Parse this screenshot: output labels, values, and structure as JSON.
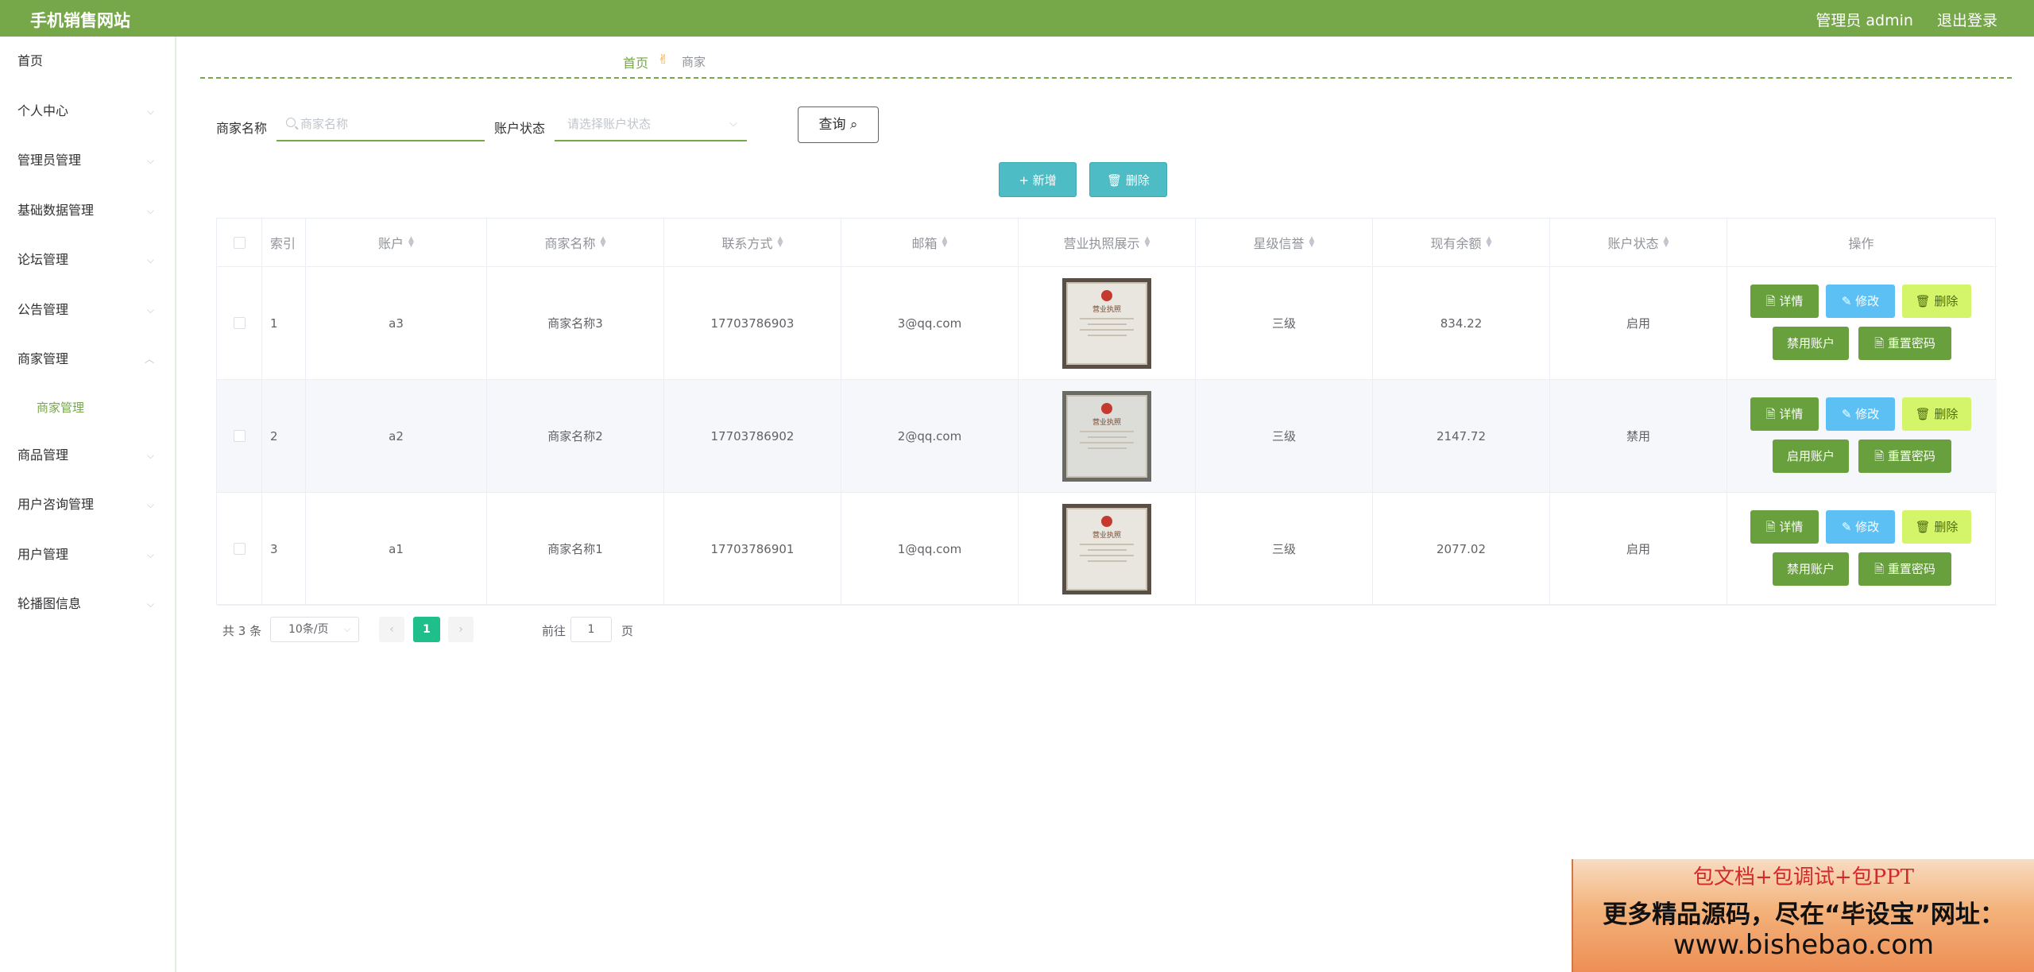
{
  "header": {
    "site_title": "手机销售网站",
    "user": "管理员 admin",
    "logout": "退出登录"
  },
  "sidebar": {
    "items": [
      {
        "label": "首页",
        "chevron": ""
      },
      {
        "label": "个人中心",
        "chevron": "⌵"
      },
      {
        "label": "管理员管理",
        "chevron": "⌵"
      },
      {
        "label": "基础数据管理",
        "chevron": "⌵"
      },
      {
        "label": "论坛管理",
        "chevron": "⌵"
      },
      {
        "label": "公告管理",
        "chevron": "⌵"
      },
      {
        "label": "商家管理",
        "chevron": "︿"
      },
      {
        "label": "商品管理",
        "chevron": "⌵"
      },
      {
        "label": "用户咨询管理",
        "chevron": "⌵"
      },
      {
        "label": "用户管理",
        "chevron": "⌵"
      },
      {
        "label": "轮播图信息",
        "chevron": "⌵"
      }
    ],
    "sub_item": "商家管理"
  },
  "breadcrumb": {
    "home": "首页",
    "sep": "✌",
    "current": "商家"
  },
  "search": {
    "name_label": "商家名称",
    "name_placeholder": "商家名称",
    "status_label": "账户状态",
    "status_placeholder": "请选择账户状态",
    "query_label": "查询 ⌕"
  },
  "toolbar": {
    "add_label": "+ 新增",
    "delete_label": "🗑 删除"
  },
  "table": {
    "headers": [
      "索引",
      "账户",
      "商家名称",
      "联系方式",
      "邮箱",
      "营业执照展示",
      "星级信誉",
      "现有余额",
      "账户状态",
      "操作"
    ],
    "rows": [
      {
        "index": "1",
        "account": "a3",
        "name": "商家名称3",
        "phone": "17703786903",
        "email": "3@qq.com",
        "credit": "三级",
        "balance": "834.22",
        "status": "启用",
        "toggle": "禁用账户"
      },
      {
        "index": "2",
        "account": "a2",
        "name": "商家名称2",
        "phone": "17703786902",
        "email": "2@qq.com",
        "credit": "三级",
        "balance": "2147.72",
        "status": "禁用",
        "toggle": "启用账户"
      },
      {
        "index": "3",
        "account": "a1",
        "name": "商家名称1",
        "phone": "17703786901",
        "email": "1@qq.com",
        "credit": "三级",
        "balance": "2077.02",
        "status": "启用",
        "toggle": "禁用账户"
      }
    ],
    "actions": {
      "detail": "🗎 详情",
      "edit": "✎ 修改",
      "delete": "🗑 删除",
      "reset": "🗎 重置密码"
    },
    "license_title": "营业执照"
  },
  "pagination": {
    "total": "共 3 条",
    "page_size": "10条/页",
    "prev": "‹",
    "next": "›",
    "current_page": "1",
    "goto_prefix": "前往",
    "goto_value": "1",
    "goto_suffix": "页"
  },
  "promo": {
    "line1": "包文档+包调试+包PPT",
    "line2": "更多精品源码，尽在“毕设宝”网址：",
    "line3": "www.bishebao.com"
  }
}
